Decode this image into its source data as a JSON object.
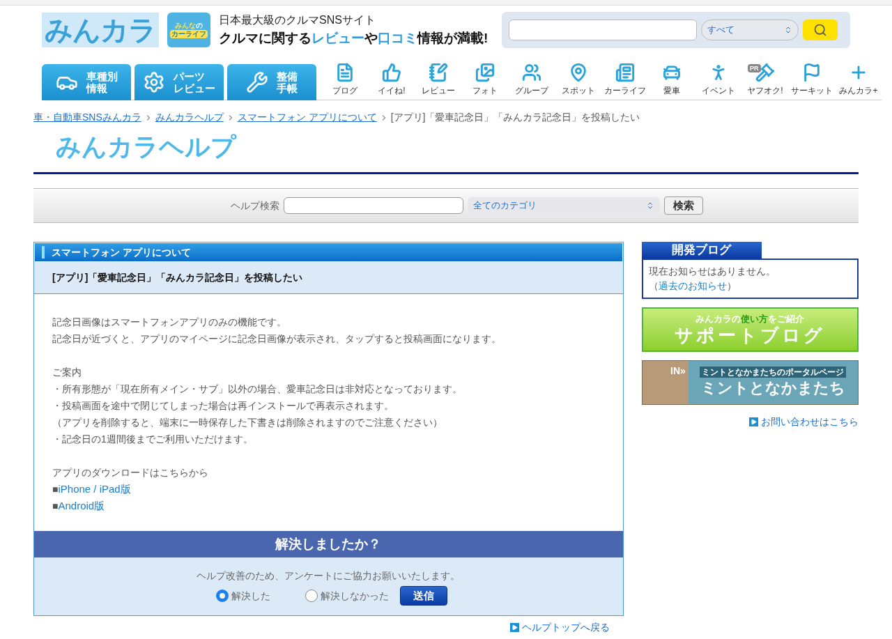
{
  "header": {
    "logo": "みんカラ",
    "badge": [
      "みんな",
      "の",
      "カーライフ"
    ],
    "tagline": "日本最大級のクルマSNSサイト",
    "catch": [
      {
        "text": "クルマに関する",
        "highlight": false
      },
      {
        "text": "レビュー",
        "highlight": true
      },
      {
        "text": "や",
        "highlight": false
      },
      {
        "text": "口コミ",
        "highlight": true
      },
      {
        "text": "情報が満載!",
        "highlight": false
      }
    ],
    "search": {
      "scope": "すべて"
    }
  },
  "main_nav": [
    {
      "lines": [
        "車種別",
        "情報"
      ]
    },
    {
      "lines": [
        "パーツ",
        "レビュー"
      ]
    },
    {
      "lines": [
        "整備",
        "手帳"
      ]
    }
  ],
  "icon_nav": [
    {
      "label": "ブログ"
    },
    {
      "label": "イイね!"
    },
    {
      "label": "レビュー"
    },
    {
      "label": "フォト"
    },
    {
      "label": "グループ"
    },
    {
      "label": "スポット"
    },
    {
      "label": "カーライフ"
    },
    {
      "label": "愛車"
    },
    {
      "label": "イベント"
    },
    {
      "label": "ヤフオク!",
      "badge": "PR"
    },
    {
      "label": "サーキット"
    },
    {
      "label": "みんカラ+"
    }
  ],
  "breadcrumb": [
    {
      "text": "車・自動車SNSみんカラ",
      "link": true
    },
    {
      "text": "みんカラヘルプ",
      "link": true
    },
    {
      "text": "スマートフォン アプリについて",
      "link": true
    },
    {
      "text": "[アプリ]「愛車記念日」「みんカラ記念日」を投稿したい",
      "link": false
    }
  ],
  "help_logo": "みんカラヘルプ",
  "help_search": {
    "label": "ヘルプ検索",
    "category": "全てのカテゴリ",
    "button": "検索"
  },
  "article": {
    "category": "スマートフォン アプリについて",
    "title": "[アプリ]「愛車記念日」「みんカラ記念日」を投稿したい",
    "paragraphs": [
      [
        {
          "kind": "text",
          "text": "記念日画像はスマートフォンアプリのみの機能です。"
        },
        {
          "kind": "text",
          "text": "記念日が近づくと、アプリのマイページに記念日画像が表示され、タップすると投稿画面になります。"
        }
      ],
      [
        {
          "kind": "text",
          "text": "ご案内"
        },
        {
          "kind": "text",
          "text": "・所有形態が「現在所有メイン・サブ」以外の場合、愛車記念日は非対応となっております。"
        },
        {
          "kind": "text",
          "text": "・投稿画面を途中で閉じてしまった場合は再インストールで再表示されます。"
        },
        {
          "kind": "text",
          "text": "（アプリを削除すると、端末に一時保存した下書きは削除されますのでご注意ください）"
        },
        {
          "kind": "text",
          "text": "・記念日の1週間後までご利用いただけます。"
        }
      ],
      [
        {
          "kind": "text",
          "text": "アプリのダウンロードはこちらから"
        },
        {
          "kind": "link",
          "bullet": "■",
          "text": "iPhone / iPad版"
        },
        {
          "kind": "link",
          "bullet": "■",
          "text": "Android版"
        }
      ]
    ]
  },
  "survey": {
    "title": "解決しましたか？",
    "prompt": "ヘルプ改善のため、アンケートにご協力お願いいたします。",
    "options": [
      {
        "label": "解決した",
        "selected": true
      },
      {
        "label": "解決しなかった",
        "selected": false
      }
    ],
    "submit": "送信"
  },
  "back_link": "ヘルプトップへ戻る",
  "sidebar": {
    "dev_blog": {
      "title": "開発ブログ",
      "message": "現在お知らせはありません。",
      "open": "（",
      "link": "過去のお知らせ",
      "close": "）"
    },
    "support_banner": {
      "pre": "みんカラの",
      "accent": "使い方",
      "post": "をご紹介",
      "title": "サポートブログ"
    },
    "mint_banner": {
      "tag": "IN»",
      "sub": "ミントとなかまたちのポータルページ",
      "title": "ミントとなかまたち"
    },
    "contact_link": "お問い合わせはこちら"
  }
}
